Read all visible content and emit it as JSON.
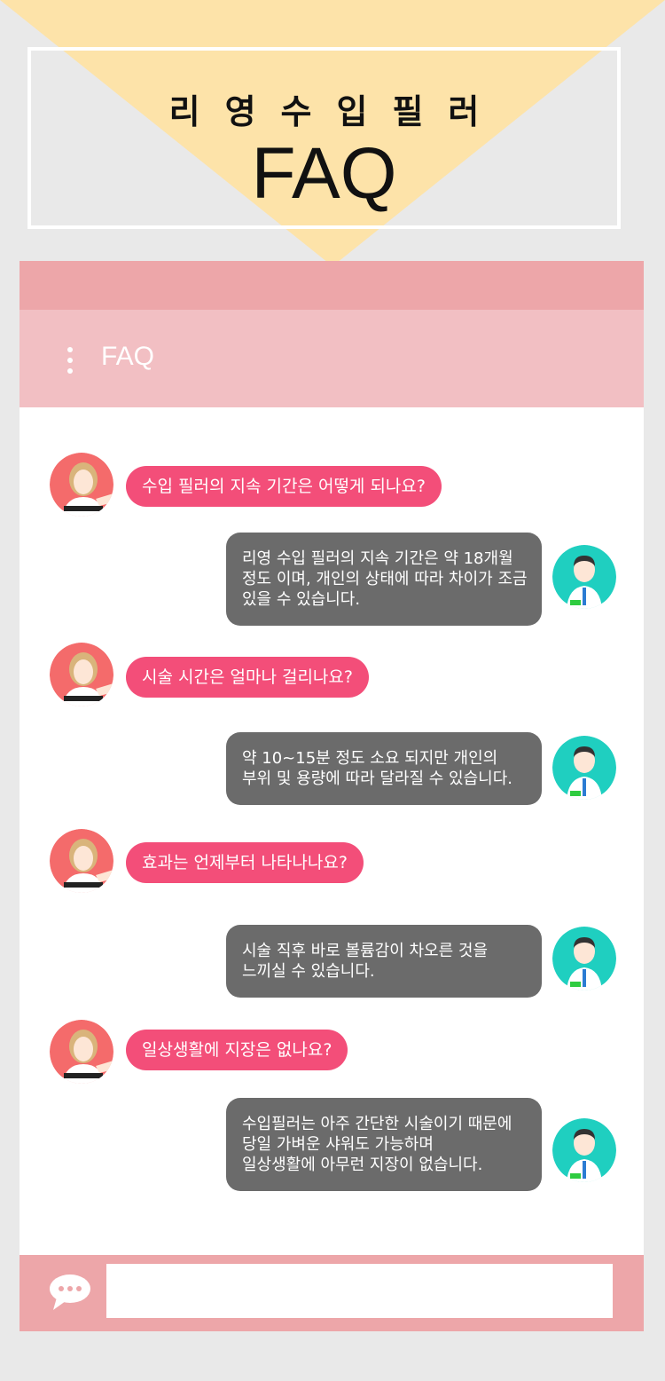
{
  "banner": {
    "title_ko": "리영수입필러",
    "title_faq": "FAQ"
  },
  "header": {
    "title": "FAQ",
    "menu_icon": "kebab-menu-icon"
  },
  "conversation": [
    {
      "question": "수입 필러의 지속 기간은 어떻게 되나요?",
      "answer_lines": [
        "리영 수입 필러의 지속 기간은 약 18개월",
        "정도 이며, 개인의 상태에 따라 차이가 조금",
        "있을 수 있습니다."
      ]
    },
    {
      "question": "시술 시간은 얼마나 걸리나요?",
      "answer_lines": [
        "약 10~15분 정도 소요 되지만 개인의",
        "부위 및 용량에 따라 달라질 수 있습니다."
      ]
    },
    {
      "question": "효과는 언제부터 나타나나요?",
      "answer_lines": [
        "시술 직후 바로 볼륨감이 차오른 것을",
        "느끼실 수 있습니다."
      ]
    },
    {
      "question": "일상생활에 지장은 없나요?",
      "answer_lines": [
        "수입필러는 아주 간단한 시술이기 때문에",
        "당일 가벼운 샤워도 가능하며",
        "일상생활에 아무런 지장이 없습니다."
      ]
    }
  ],
  "input": {
    "placeholder": "",
    "chat_icon": "speech-bubble-icon"
  },
  "colors": {
    "triangle": "#fde3a9",
    "phone_top": "#eda6a9",
    "phone_bar": "#f2bfc3",
    "question_bubble": "#f34e79",
    "answer_bubble": "#6b6b6b",
    "doctor_bg": "#1fcfc0",
    "patient_bg": "#f46b6b"
  }
}
